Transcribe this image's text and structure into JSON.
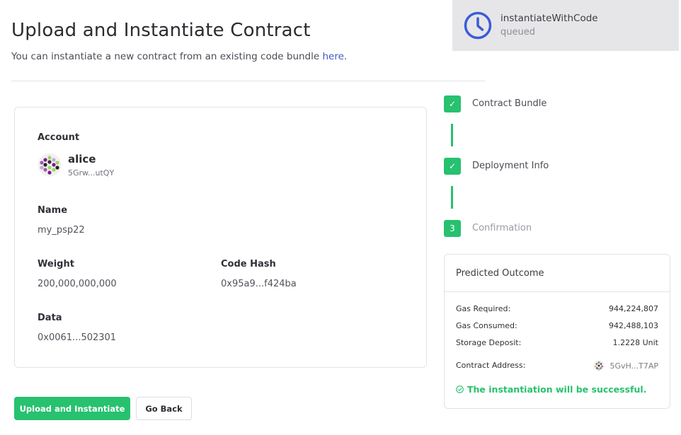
{
  "header": {
    "title": "Upload and Instantiate Contract",
    "subtitle_prefix": "You can instantiate a new contract from an existing code bundle ",
    "subtitle_link": "here",
    "subtitle_suffix": "."
  },
  "toast": {
    "title": "instantiateWithCode",
    "status": "queued",
    "icon": "clock-icon",
    "accent": "#3b5cd8"
  },
  "details": {
    "account_label": "Account",
    "account_name": "alice",
    "account_address": "5Grw...utQY",
    "name_label": "Name",
    "name_value": "my_psp22",
    "weight_label": "Weight",
    "weight_value": "200,000,000,000",
    "codehash_label": "Code Hash",
    "codehash_value": "0x95a9...f424ba",
    "data_label": "Data",
    "data_value": "0x0061...502301"
  },
  "actions": {
    "primary_label": "Upload and Instantiate",
    "secondary_label": "Go Back"
  },
  "steps": [
    {
      "label": "Contract Bundle",
      "state": "done",
      "marker": "✓"
    },
    {
      "label": "Deployment Info",
      "state": "done",
      "marker": "✓"
    },
    {
      "label": "Confirmation",
      "state": "current",
      "marker": "3"
    }
  ],
  "outcome": {
    "title": "Predicted Outcome",
    "rows": [
      {
        "label": "Gas Required:",
        "value": "944,224,807"
      },
      {
        "label": "Gas Consumed:",
        "value": "942,488,103"
      },
      {
        "label": "Storage Deposit:",
        "value": "1.2228 Unit"
      }
    ],
    "contract_address_label": "Contract Address:",
    "contract_address_value": "5GvH...T7AP",
    "success_message": "The instantiation will be successful."
  },
  "colors": {
    "accent_green": "#27c16f",
    "link_blue": "#3b5cc4"
  }
}
